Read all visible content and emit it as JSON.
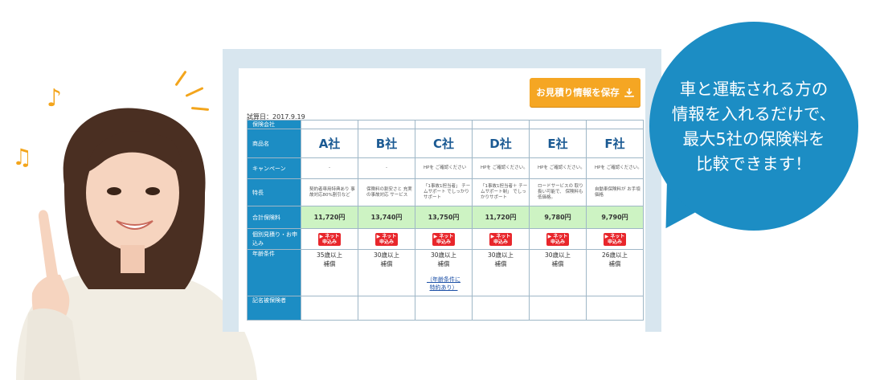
{
  "bubble": {
    "lines": [
      "車と運転される方の",
      "情報を入れるだけで、",
      "最大5社の保険料を",
      "比較できます！"
    ]
  },
  "screen": {
    "save_button": "お見積り情報を保存",
    "date": "試算日：2017.9.19",
    "row_headers": {
      "company": "保険会社",
      "product": "商品名",
      "campaign": "キャンペーン",
      "feature": "特長",
      "total": "合計保険料",
      "apply": "個別見積り・お申込み",
      "age": "年齢条件",
      "insured": "記名被保険者"
    },
    "companies": [
      {
        "name": "A社",
        "campaign": "-",
        "feature": "契約者専用特典あり 事故対応80%割引など",
        "total": "11,720円",
        "net": "ネット申込み",
        "age1": "35歳以上",
        "age2": "補償"
      },
      {
        "name": "B社",
        "campaign": "-",
        "feature": "保険料の割安さと 充実の事故対応 サービス",
        "total": "13,740円",
        "net": "ネット申込み",
        "age1": "30歳以上",
        "age2": "補償"
      },
      {
        "name": "C社",
        "campaign": "HPを ご確認ください",
        "feature": "「1事故1担当者」 チームサポート でしっかりサポート",
        "total": "13,750円",
        "net": "ネット申込み",
        "age1": "30歳以上",
        "age2": "補償",
        "note1": "（年齢条件に",
        "note2": "特約あり）"
      },
      {
        "name": "D社",
        "campaign": "HPを ご確認ください。",
        "feature": "「1事故1担当者＋ チームサポート制」 でしっかりサポート",
        "total": "11,720円",
        "net": "ネット申込み",
        "age1": "30歳以上",
        "age2": "補償"
      },
      {
        "name": "E社",
        "campaign": "HPを ご確認ください。",
        "feature": "ロードサービスの 取り扱い可能で、 保険料も低価格。",
        "total": "9,780円",
        "net": "ネット申込み",
        "age1": "30歳以上",
        "age2": "補償"
      },
      {
        "name": "F社",
        "campaign": "HPを ご確認ください。",
        "feature": "自動車保険料が お手頃価格",
        "total": "9,790円",
        "net": "ネット申込み",
        "age1": "26歳以上",
        "age2": "補償"
      }
    ]
  },
  "colors": {
    "accent": "#1c8dc4",
    "orange": "#f5a623",
    "price_bg": "#cdf3c3",
    "net_red": "#e8262b"
  },
  "icons": [
    "music-note-icon",
    "download-icon"
  ]
}
